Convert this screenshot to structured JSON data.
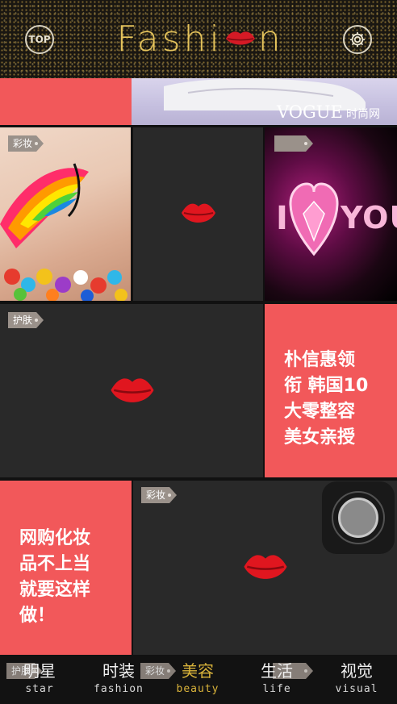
{
  "header": {
    "top_label": "TOP",
    "brand_prefix": "Fashi",
    "brand_suffix": "n",
    "accent_gold": "#e4c35c"
  },
  "banner": {
    "vogue": "VOGUE",
    "site": "时尚网"
  },
  "tiles": {
    "tag_makeup": "彩妆",
    "tag_skincare": "护肤",
    "heart_left": "I",
    "heart_right": "YOU",
    "promo_korea": [
      "朴信惠领",
      "衔 韩国10",
      "大零整容",
      "美女亲授"
    ],
    "promo_shopping": [
      "网购化妆",
      "品不上当",
      "就要这样",
      "做！"
    ],
    "coral": "#f2585a"
  },
  "overlay_tags": {
    "tag1": "护肤",
    "tag2": "彩妆"
  },
  "tabbar": {
    "tabs": [
      {
        "cn": "明星",
        "en": "star"
      },
      {
        "cn": "时装",
        "en": "fashion"
      },
      {
        "cn": "美容",
        "en": "beauty"
      },
      {
        "cn": "生活",
        "en": "life"
      },
      {
        "cn": "视觉",
        "en": "visual"
      }
    ],
    "active_index": 2
  }
}
